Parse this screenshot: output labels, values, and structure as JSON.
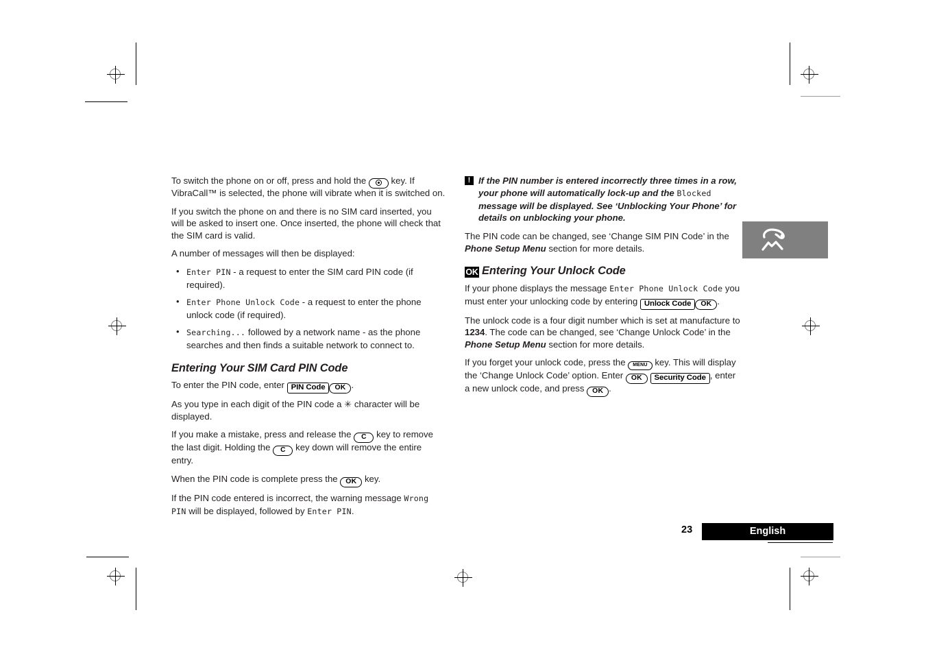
{
  "document": {
    "page_number": "23",
    "language_label": "English",
    "side_tab_icon": "phone-handset-icon"
  },
  "left_column": {
    "paragraphs": [
      {
        "id": "p-switch-on-off",
        "runs": [
          {
            "t": "To switch the phone on or off, press and hold the ",
            "s": "plain"
          },
          {
            "t": "power-key",
            "s": "key-power"
          },
          {
            "t": " key. If VibraCall™ is selected, the phone will vibrate when it is switched on.",
            "s": "plain"
          }
        ]
      },
      {
        "id": "p-no-sim",
        "runs": [
          {
            "t": "If you switch the phone on and there is no SIM card inserted, you will be asked to insert one. Once inserted, the phone will check that the SIM card is valid.",
            "s": "plain"
          }
        ]
      },
      {
        "id": "p-messages-intro",
        "runs": [
          {
            "t": "A number of messages will then be displayed:",
            "s": "plain"
          }
        ]
      }
    ],
    "bullets": [
      {
        "id": "bullet-enter-pin",
        "runs": [
          {
            "t": "Enter PIN",
            "s": "lcd"
          },
          {
            "t": " - a request to enter the SIM card PIN code (if required).",
            "s": "plain"
          }
        ]
      },
      {
        "id": "bullet-enter-phone-unlock-code",
        "runs": [
          {
            "t": "Enter Phone Unlock Code",
            "s": "lcd"
          },
          {
            "t": " - a request to enter the phone unlock code (if required).",
            "s": "plain"
          }
        ]
      },
      {
        "id": "bullet-searching",
        "runs": [
          {
            "t": "Searching...",
            "s": "lcd"
          },
          {
            "t": " followed by a network name - as the phone searches and then finds a suitable network to connect to.",
            "s": "plain"
          }
        ]
      }
    ],
    "section_heading": "Entering Your SIM Card PIN Code",
    "section_paragraphs": [
      {
        "id": "p-enter-pin-code",
        "runs": [
          {
            "t": "To enter the PIN code, enter ",
            "s": "plain"
          },
          {
            "t": "PIN Code",
            "s": "key-box"
          },
          {
            "t": "OK",
            "s": "key-ok"
          },
          {
            "t": ".",
            "s": "plain"
          }
        ]
      },
      {
        "id": "p-asterisk",
        "runs": [
          {
            "t": "As you type in each digit of the PIN code a ✳ character will be displayed.",
            "s": "plain"
          }
        ]
      },
      {
        "id": "p-mistake",
        "runs": [
          {
            "t": "If you make a mistake, press and release the ",
            "s": "plain"
          },
          {
            "t": "C",
            "s": "key-c"
          },
          {
            "t": " key to remove the last digit. Holding the ",
            "s": "plain"
          },
          {
            "t": "C",
            "s": "key-c"
          },
          {
            "t": " key down will remove the entire entry.",
            "s": "plain"
          }
        ]
      },
      {
        "id": "p-complete",
        "runs": [
          {
            "t": "When the PIN code is complete press the ",
            "s": "plain"
          },
          {
            "t": "OK",
            "s": "key-ok"
          },
          {
            "t": " key.",
            "s": "plain"
          }
        ]
      },
      {
        "id": "p-wrong-pin",
        "runs": [
          {
            "t": "If the PIN code entered is incorrect, the warning message ",
            "s": "plain"
          },
          {
            "t": "Wrong PIN",
            "s": "lcd"
          },
          {
            "t": " will be displayed, followed by ",
            "s": "plain"
          },
          {
            "t": "Enter PIN",
            "s": "lcd"
          },
          {
            "t": ".",
            "s": "plain"
          }
        ]
      }
    ]
  },
  "right_column": {
    "note": {
      "icon": "warning-exclamation-icon",
      "icon_glyph": "!",
      "runs": [
        {
          "t": "If the PIN number is entered incorrectly three times in a row, your phone will automatically lock-up and the ",
          "s": "plain"
        },
        {
          "t": "Blocked",
          "s": "lcd"
        },
        {
          "t": " message will be displayed. See ‘Unblocking Your Phone’ for details on unblocking your phone.",
          "s": "plain"
        }
      ]
    },
    "note_follow": {
      "id": "p-pin-change",
      "runs": [
        {
          "t": "The PIN code can be changed, see ‘Change SIM PIN Code’ in the ",
          "s": "plain"
        },
        {
          "t": "Phone Setup Menu",
          "s": "bi"
        },
        {
          "t": " section for more details.",
          "s": "plain"
        }
      ]
    },
    "section_heading": {
      "icon": "ok-badge-icon",
      "icon_glyph": "OK",
      "text": "Entering Your Unlock Code"
    },
    "section_paragraphs": [
      {
        "id": "p-unlock-prompt",
        "runs": [
          {
            "t": "If your phone displays the message ",
            "s": "plain"
          },
          {
            "t": "Enter Phone Unlock Code",
            "s": "lcd"
          },
          {
            "t": " you must enter your unlocking code by entering ",
            "s": "plain"
          },
          {
            "t": "Unlock Code",
            "s": "key-box"
          },
          {
            "t": "OK",
            "s": "key-ok"
          },
          {
            "t": ".",
            "s": "plain"
          }
        ]
      },
      {
        "id": "p-unlock-default",
        "runs": [
          {
            "t": "The unlock code is a four digit number which is set at manufacture to ",
            "s": "plain"
          },
          {
            "t": "1234",
            "s": "b"
          },
          {
            "t": ". The code can be changed, see ‘Change Unlock Code’ in the ",
            "s": "plain"
          },
          {
            "t": "Phone Setup Menu",
            "s": "bi"
          },
          {
            "t": " section for more details.",
            "s": "plain"
          }
        ]
      },
      {
        "id": "p-forgot-unlock",
        "runs": [
          {
            "t": "If you forget your unlock code, press the ",
            "s": "plain"
          },
          {
            "t": "MENU",
            "s": "key-menu"
          },
          {
            "t": " key. This will display the ‘Change Unlock Code’ option. Enter ",
            "s": "plain"
          },
          {
            "t": "OK",
            "s": "key-ok"
          },
          {
            "t": " ",
            "s": "plain"
          },
          {
            "t": "Security Code",
            "s": "key-box"
          },
          {
            "t": ", enter a new unlock code, and press ",
            "s": "plain"
          },
          {
            "t": "OK",
            "s": "key-ok"
          },
          {
            "t": ".",
            "s": "plain"
          }
        ]
      }
    ]
  }
}
